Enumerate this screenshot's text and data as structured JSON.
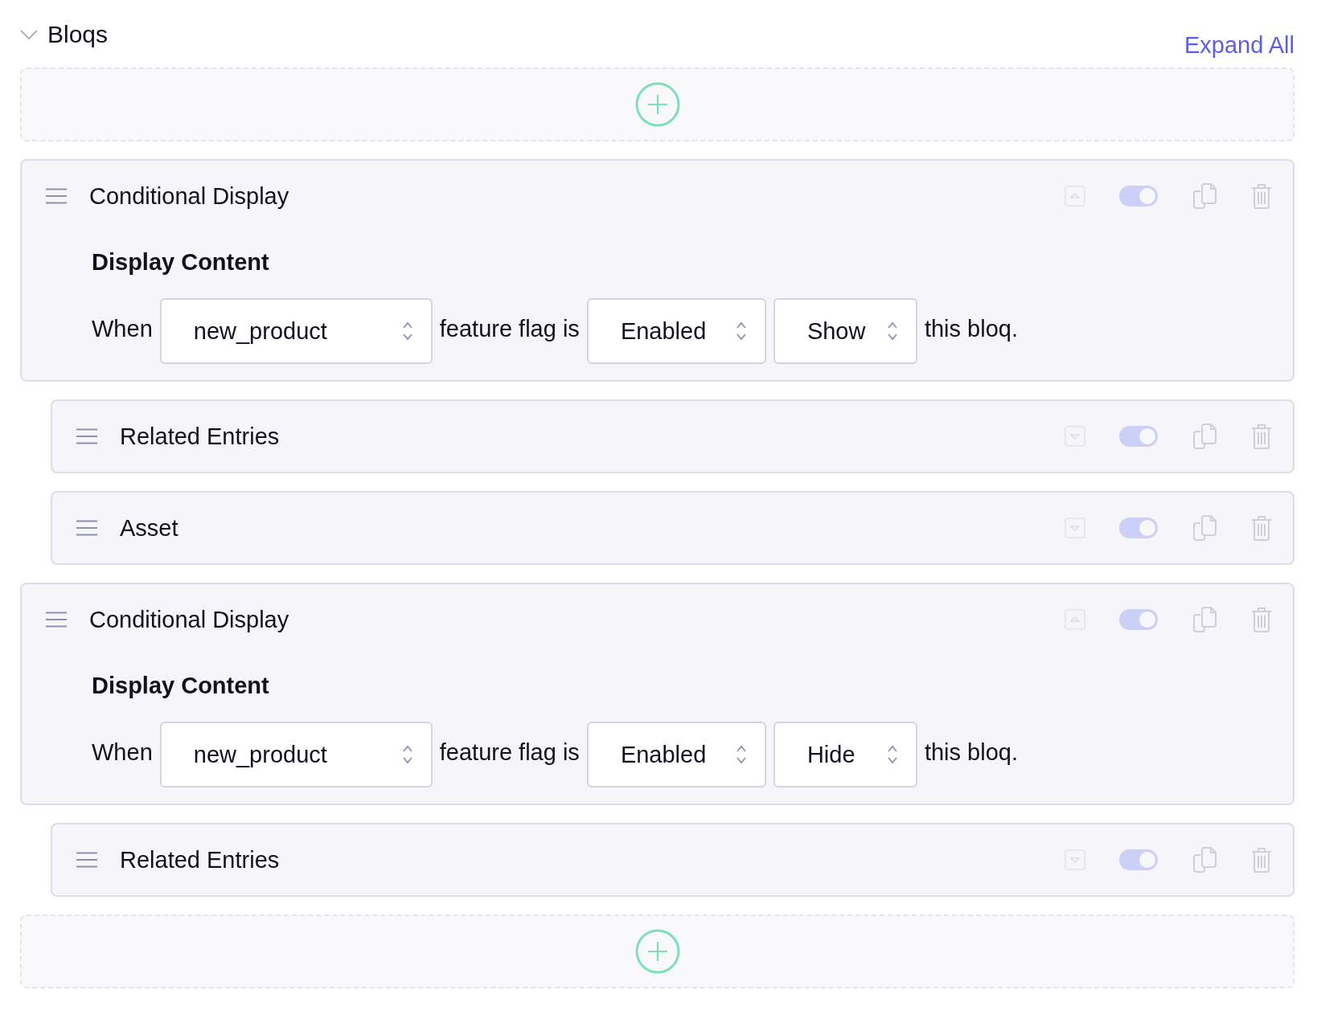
{
  "section": {
    "title": "Bloqs",
    "expanded": true,
    "expand_all": "Expand All"
  },
  "blocks": [
    {
      "kind": "conditional",
      "title": "Conditional Display",
      "expanded": true,
      "enabled": true,
      "heading": "Display Content",
      "rule": {
        "when": "When",
        "flag": "new_product",
        "middle": "feature flag is",
        "state": "Enabled",
        "action": "Show",
        "end": "this bloq."
      },
      "children": [
        {
          "kind": "entry",
          "title": "Related Entries",
          "expanded": false,
          "enabled": true
        },
        {
          "kind": "entry",
          "title": "Asset",
          "expanded": false,
          "enabled": true
        }
      ]
    },
    {
      "kind": "conditional",
      "title": "Conditional Display",
      "expanded": true,
      "enabled": true,
      "heading": "Display Content",
      "rule": {
        "when": "When",
        "flag": "new_product",
        "middle": "feature flag is",
        "state": "Enabled",
        "action": "Hide",
        "end": "this bloq."
      },
      "children": [
        {
          "kind": "entry",
          "title": "Related Entries",
          "expanded": false,
          "enabled": true
        }
      ]
    }
  ]
}
